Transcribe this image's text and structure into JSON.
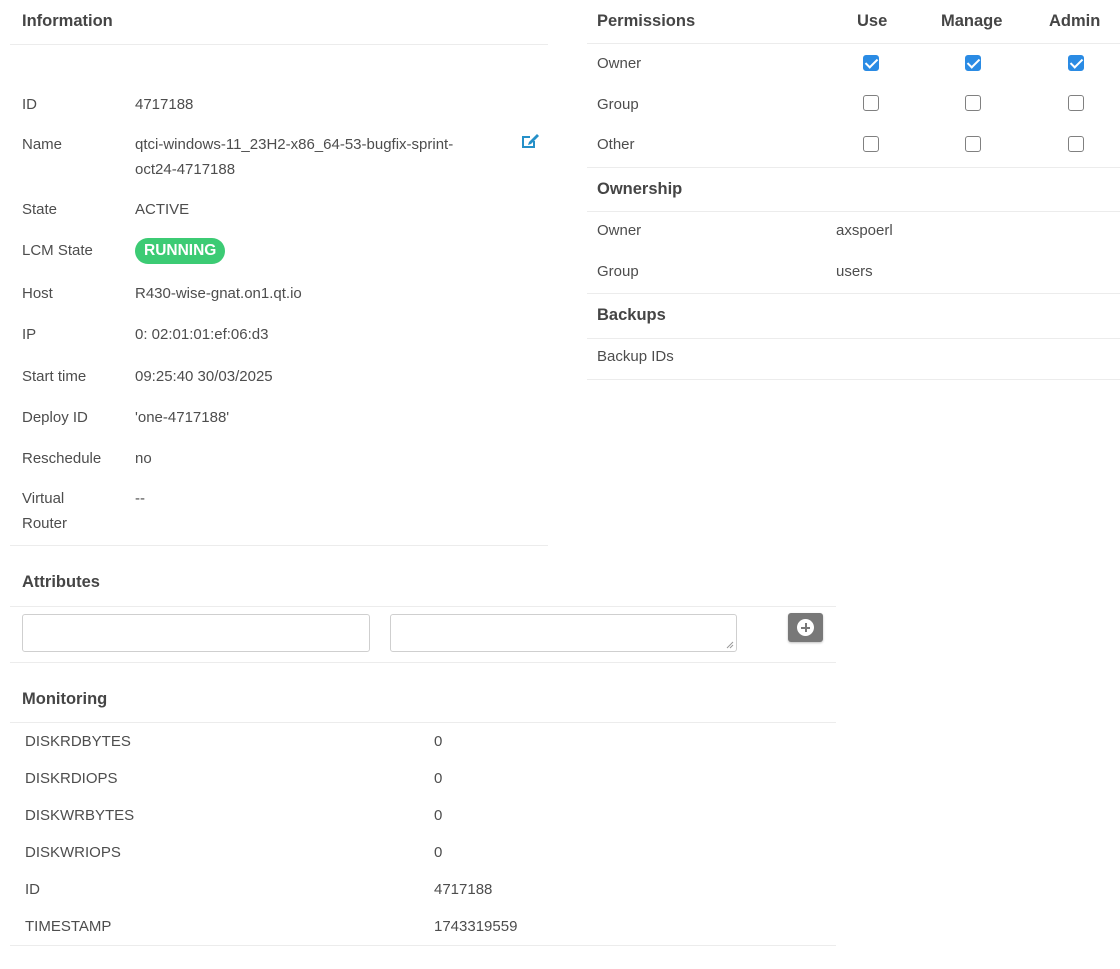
{
  "information": {
    "title": "Information",
    "rows": [
      {
        "label": "ID",
        "value": "4717188"
      },
      {
        "label": "Name",
        "value_line1": "qtci-windows-11_23H2-x86_64-53-bugfix-sprint-",
        "value_line2": "oct24-4717188"
      },
      {
        "label": "State",
        "value": "ACTIVE"
      },
      {
        "label": "LCM State",
        "value": "RUNNING"
      },
      {
        "label": "Host",
        "value": "R430-wise-gnat.on1.qt.io"
      },
      {
        "label": "IP",
        "value": "0: 02:01:01:ef:06:d3"
      },
      {
        "label": "Start time",
        "value": "09:25:40 30/03/2025"
      },
      {
        "label": "Deploy ID",
        "value": "'one-4717188'"
      },
      {
        "label": "Reschedule",
        "value": "no"
      },
      {
        "label_line1": "Virtual",
        "label_line2": "Router",
        "value": "--"
      }
    ]
  },
  "permissions": {
    "title": "Permissions",
    "columns": [
      "Use",
      "Manage",
      "Admin"
    ],
    "rows": [
      {
        "label": "Owner",
        "use": true,
        "manage": true,
        "admin": true
      },
      {
        "label": "Group",
        "use": false,
        "manage": false,
        "admin": false
      },
      {
        "label": "Other",
        "use": false,
        "manage": false,
        "admin": false
      }
    ]
  },
  "ownership": {
    "title": "Ownership",
    "rows": [
      {
        "label": "Owner",
        "value": "axspoerl"
      },
      {
        "label": "Group",
        "value": "users"
      }
    ]
  },
  "backups": {
    "title": "Backups",
    "rows": [
      {
        "label": "Backup IDs",
        "value": ""
      }
    ]
  },
  "attributes": {
    "title": "Attributes",
    "key_value": "",
    "value_value": ""
  },
  "monitoring": {
    "title": "Monitoring",
    "rows": [
      {
        "label": "DISKRDBYTES",
        "value": "0"
      },
      {
        "label": "DISKRDIOPS",
        "value": "0"
      },
      {
        "label": "DISKWRBYTES",
        "value": "0"
      },
      {
        "label": "DISKWRIOPS",
        "value": "0"
      },
      {
        "label": "ID",
        "value": "4717188"
      },
      {
        "label": "TIMESTAMP",
        "value": "1743319559"
      }
    ]
  },
  "icons": {
    "edit": "edit-icon",
    "add": "plus-circle-icon",
    "checkbox_checked": "checkbox-checked-icon",
    "checkbox_empty": "checkbox-empty-icon"
  },
  "colors": {
    "running_badge": "#3ccb74",
    "checkbox_checked": "#2a8be4",
    "edit_icon": "#2590c8"
  }
}
